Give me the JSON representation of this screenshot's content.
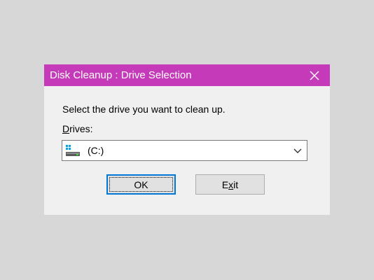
{
  "window": {
    "title": "Disk Cleanup : Drive Selection",
    "close_icon": "close-icon",
    "titlebar_color": "#c53ab8"
  },
  "content": {
    "prompt": "Select the drive you want to clean up.",
    "drives_label_accel": "D",
    "drives_label_rest": "rives:",
    "drive_select": {
      "icon": "hard-drive-icon",
      "value": "(C:)"
    }
  },
  "buttons": {
    "ok_label": "OK",
    "exit_label_before": "E",
    "exit_label_accel": "x",
    "exit_label_after": "it",
    "focus_color": "#0078d7"
  }
}
